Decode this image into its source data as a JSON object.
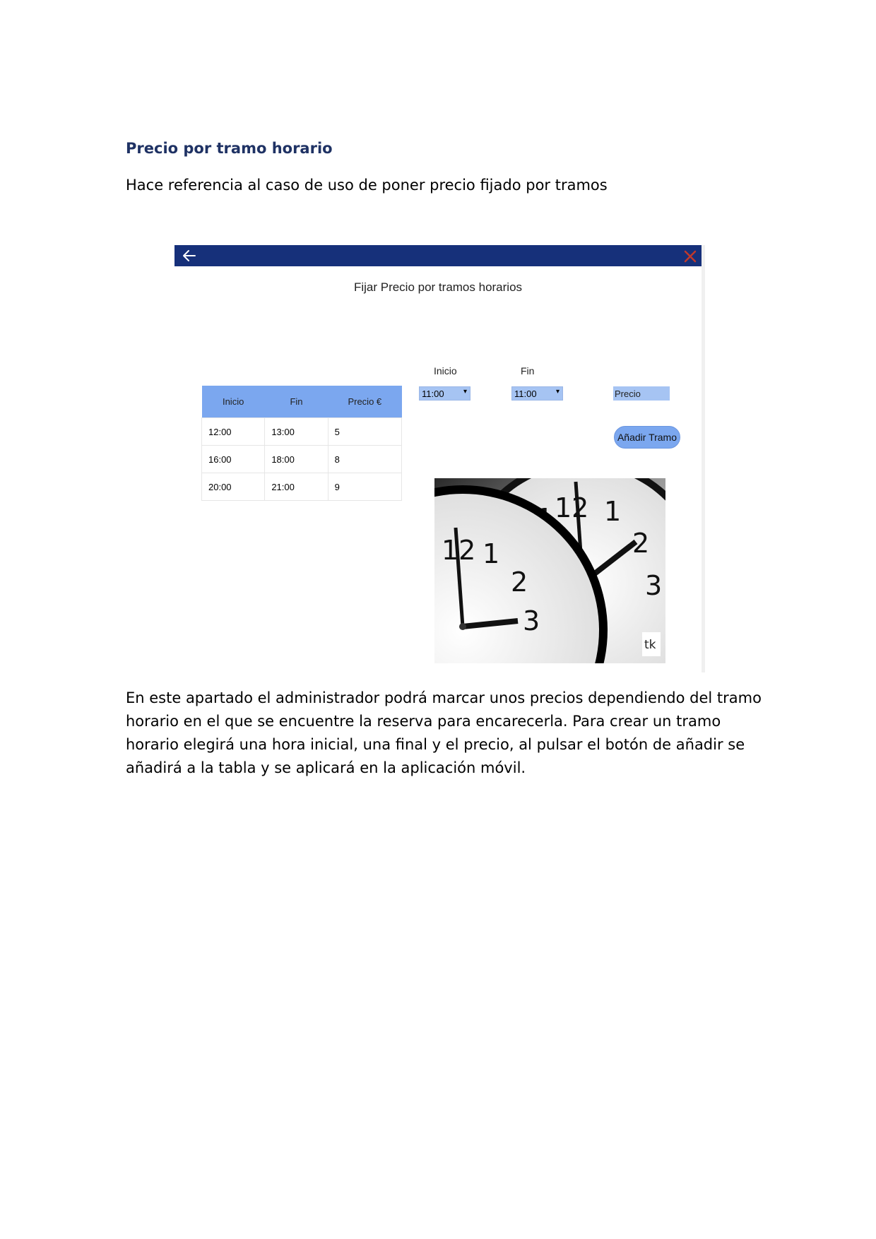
{
  "document": {
    "heading": "Precio por tramo horario",
    "intro": "Hace referencia al caso de uso de poner precio fijado por tramos",
    "body_lines": [
      "En este apartado el administrador podrá marcar unos precios dependiendo del tramo",
      "horario en el que se encuentre la reserva para encarecerla. Para crear un tramo",
      "horario elegirá una hora inicial, una final y el precio, al pulsar el botón de añadir se",
      "añadirá a la tabla y se aplicará en la aplicación móvil."
    ]
  },
  "app": {
    "title": "Fijar Precio por tramos horarios",
    "colors": {
      "titlebar": "#16307a",
      "accent": "#7ba7ef",
      "input_bg": "#a6c4f3",
      "close": "#c0392b"
    },
    "icons": {
      "back": "arrow-left-icon",
      "close": "close-icon"
    },
    "form": {
      "inicio_label": "Inicio",
      "inicio_value": "11:00",
      "fin_label": "Fin",
      "fin_value": "11:00",
      "precio_placeholder": "Precio",
      "add_button": "Añadir Tramo"
    },
    "table": {
      "headers": [
        "Inicio",
        "Fin",
        "Precio €"
      ],
      "rows": [
        [
          "12:00",
          "13:00",
          "5"
        ],
        [
          "16:00",
          "18:00",
          "8"
        ],
        [
          "20:00",
          "21:00",
          "9"
        ]
      ]
    },
    "image": {
      "watermark": "tk"
    }
  }
}
